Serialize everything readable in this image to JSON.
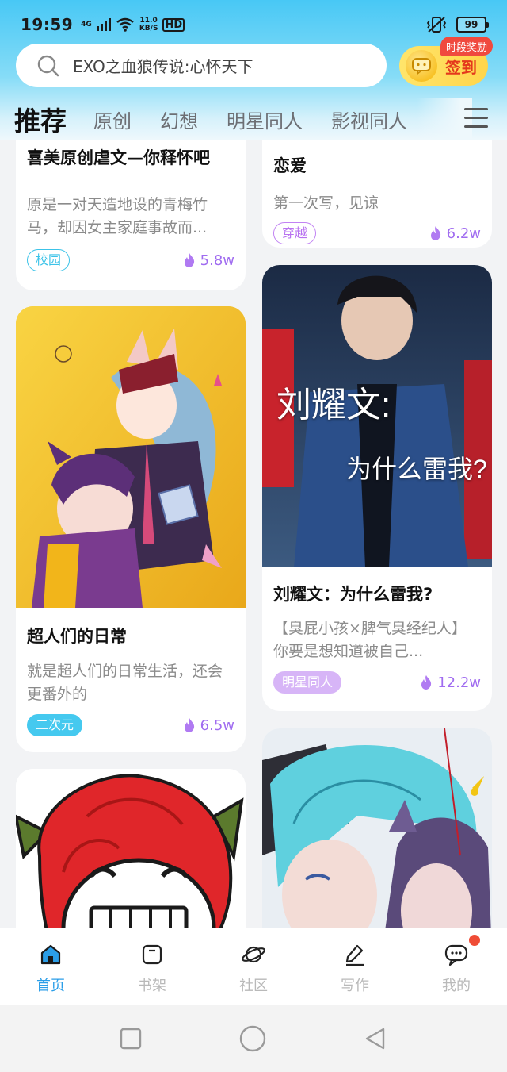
{
  "status_bar": {
    "time": "19:59",
    "network": "4G",
    "speed_value": "11.0",
    "speed_unit": "KB/S",
    "hd": "HD",
    "battery": "99"
  },
  "search": {
    "text": "EXO之血狼传说:心怀天下"
  },
  "checkin": {
    "label": "签到",
    "badge": "时段奖励"
  },
  "tabs": [
    {
      "label": "推荐",
      "active": true
    },
    {
      "label": "原创"
    },
    {
      "label": "幻想"
    },
    {
      "label": "明星同人"
    },
    {
      "label": "影视同人"
    }
  ],
  "cards": {
    "c1": {
      "title": "喜美原创虐文—你释怀吧",
      "desc": "原是一对天造地设的青梅竹马，却因女主家庭事故而...",
      "tag": "校园",
      "heat": "5.8w"
    },
    "c2": {
      "title": "恋爱",
      "desc": "第一次写，见谅",
      "tag": "穿越",
      "heat": "6.2w"
    },
    "c3": {
      "title": "超人们的日常",
      "desc": "就是超人们的日常生活，还会更番外的",
      "tag": "二次元",
      "heat": "6.5w"
    },
    "c4": {
      "title": "刘耀文：为什么雷我?",
      "desc": "【臭屁小孩×脾气臭经纪人】你要是想知道被自己...",
      "tag": "明星同人",
      "heat": "12.2w",
      "cover_line1": "刘耀文:",
      "cover_line2": "为什么雷我?"
    }
  },
  "bottom_nav": [
    {
      "label": "首页",
      "icon": "home-icon",
      "active": true
    },
    {
      "label": "书架",
      "icon": "bookshelf-icon"
    },
    {
      "label": "社区",
      "icon": "planet-icon"
    },
    {
      "label": "写作",
      "icon": "pen-icon"
    },
    {
      "label": "我的",
      "icon": "chat-bubble-icon"
    }
  ],
  "colors": {
    "accent_blue": "#2b9ee8",
    "heat_purple": "#a06cf0",
    "checkin_yellow": "#ffd54a",
    "badge_red": "#f04a3e"
  }
}
